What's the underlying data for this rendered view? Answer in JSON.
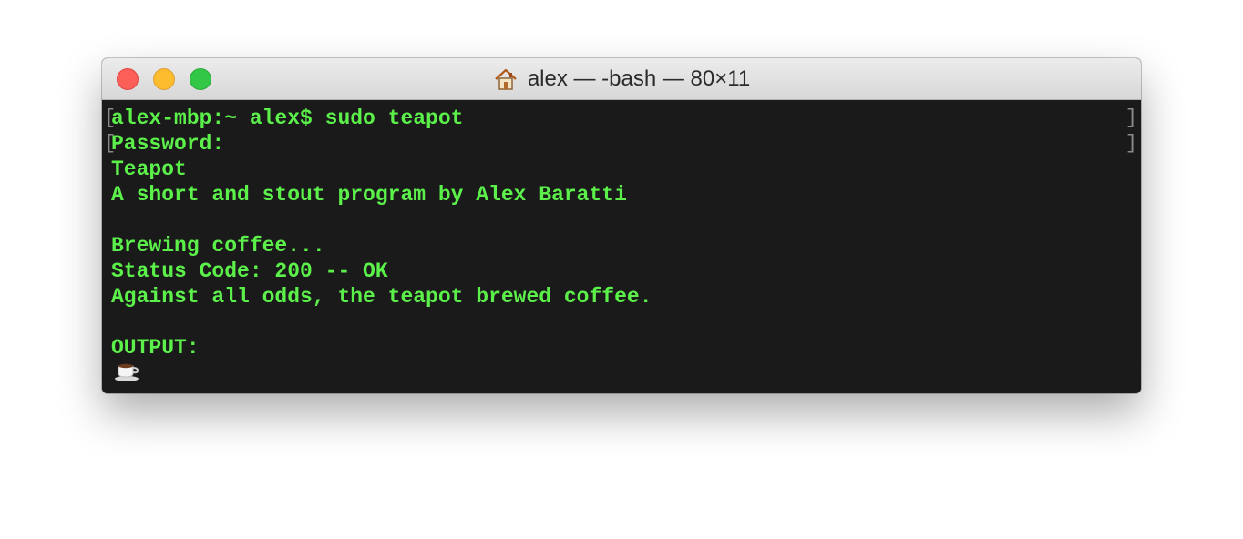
{
  "window": {
    "title": "alex — -bash — 80×11",
    "title_icon": "home-icon",
    "accent_text_color": "#5cf04a",
    "background_color": "#1a1a1a"
  },
  "terminal": {
    "lines": [
      "alex-mbp:~ alex$ sudo teapot",
      "Password:",
      "Teapot",
      "A short and stout program by Alex Baratti",
      "",
      "Brewing coffee...",
      "Status Code: 200 -- OK",
      "Against all odds, the teapot brewed coffee.",
      "",
      "OUTPUT:"
    ],
    "output_icon": "coffee-cup-icon"
  }
}
